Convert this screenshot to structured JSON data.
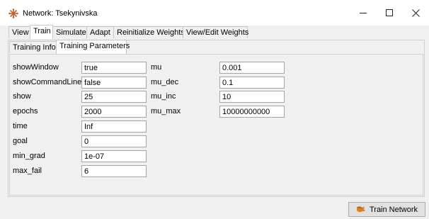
{
  "window": {
    "title": "Network: Tsekynivska",
    "controls": {
      "minimize": "–",
      "maximize": "☐",
      "close": "✕"
    }
  },
  "tabs": [
    {
      "label": "View",
      "active": false
    },
    {
      "label": "Train",
      "active": true
    },
    {
      "label": "Simulate",
      "active": false
    },
    {
      "label": "Adapt",
      "active": false
    },
    {
      "label": "Reinitialize Weights",
      "active": false
    },
    {
      "label": "View/Edit Weights",
      "active": false
    }
  ],
  "subtabs": [
    {
      "label": "Training Info",
      "active": false
    },
    {
      "label": "Training Parameters",
      "active": true
    }
  ],
  "params_left": [
    {
      "name": "showWindow",
      "value": "true"
    },
    {
      "name": "showCommandLine",
      "value": "false"
    },
    {
      "name": "show",
      "value": "25"
    },
    {
      "name": "epochs",
      "value": "2000"
    },
    {
      "name": "time",
      "value": "Inf"
    },
    {
      "name": "goal",
      "value": "0"
    },
    {
      "name": "min_grad",
      "value": "1e-07"
    },
    {
      "name": "max_fail",
      "value": "6"
    }
  ],
  "params_right": [
    {
      "name": "mu",
      "value": "0.001"
    },
    {
      "name": "mu_dec",
      "value": "0.1"
    },
    {
      "name": "mu_inc",
      "value": "10"
    },
    {
      "name": "mu_max",
      "value": "10000000000"
    }
  ],
  "train_button": {
    "label": "Train Network",
    "icon": "train-network-icon"
  }
}
